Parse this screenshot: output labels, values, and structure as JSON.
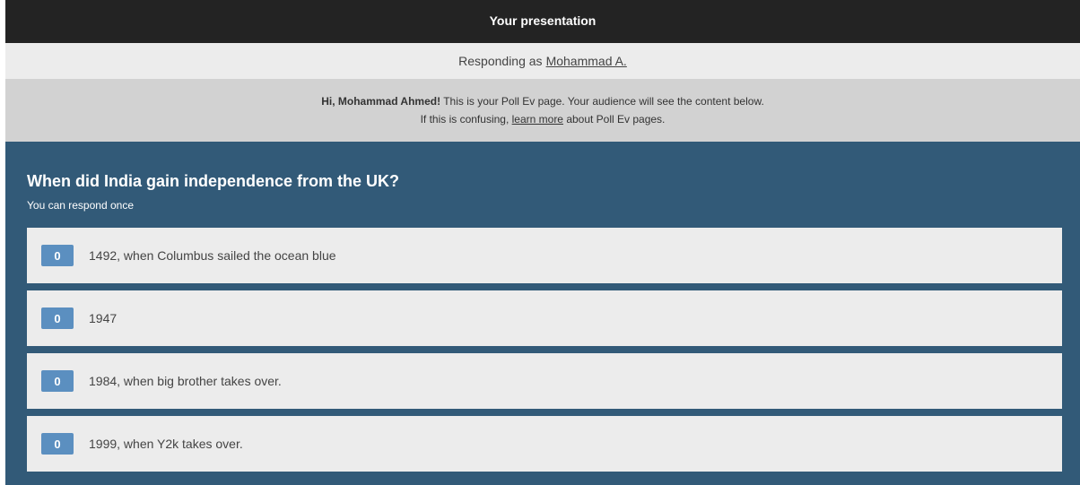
{
  "header": {
    "title": "Your presentation"
  },
  "responding": {
    "prefix": "Responding as",
    "name": "Mohammad A."
  },
  "notice": {
    "greeting": "Hi, Mohammad Ahmed!",
    "line1_rest": " This is your Poll Ev page. Your audience will see the content below.",
    "line2_prefix": "If this is confusing, ",
    "learn_more": "learn more",
    "line2_suffix": " about Poll Ev pages."
  },
  "poll": {
    "question": "When did India gain independence from the UK?",
    "respond_note": "You can respond once",
    "options": [
      {
        "count": "0",
        "label": "1492, when Columbus sailed the ocean blue"
      },
      {
        "count": "0",
        "label": "1947"
      },
      {
        "count": "0",
        "label": "1984, when big brother takes over."
      },
      {
        "count": "0",
        "label": "1999, when Y2k takes over."
      }
    ]
  },
  "colors": {
    "topbar": "#232323",
    "poll_background": "#325a78",
    "count_badge": "#5b8fc0"
  }
}
